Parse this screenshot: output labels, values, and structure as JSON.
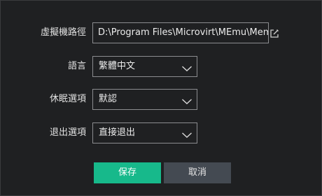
{
  "settings": {
    "path": {
      "label": "虛擬機路徑",
      "value": "D:\\Program Files\\Microvirt\\MEmu\\MemuHyperv VMs"
    },
    "language": {
      "label": "語言",
      "selected": "繁體中文"
    },
    "sleep_option": {
      "label": "休眠選項",
      "selected": "默認"
    },
    "exit_option": {
      "label": "退出選項",
      "selected": "直接退出"
    }
  },
  "buttons": {
    "save_label": "保存",
    "cancel_label": "取消"
  },
  "icons": {
    "path_edit": "edit-icon",
    "dropdown": "chevron-down-icon"
  },
  "colors": {
    "background": "#1f2022",
    "field_border": "#8c8d90",
    "save_button": "#17b98b",
    "cancel_button": "#444a52",
    "text": "#e2e2e2"
  }
}
